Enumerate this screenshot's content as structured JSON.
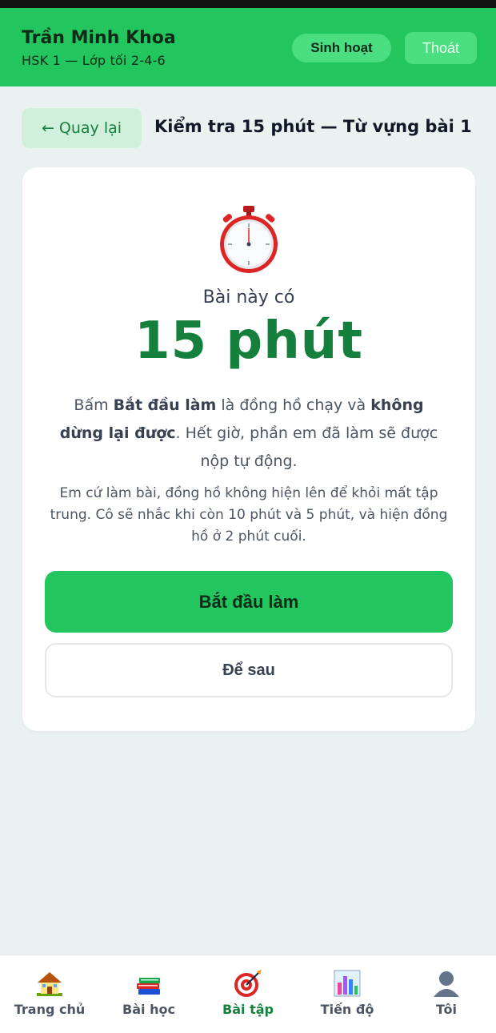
{
  "header": {
    "user_name": "Trần Minh Khoa",
    "class_name": "HSK 1 — Lớp tối 2-4-6",
    "activity_label": "Sinh hoạt",
    "logout_label": "Thoát"
  },
  "nav_bar": {
    "back_label": "Quay lại",
    "page_title": "Kiểm tra 15 phút — Từ vựng bài 1"
  },
  "card": {
    "has_text": "Bài này có",
    "duration": "15 phút",
    "para1": {
      "t1": "Bấm ",
      "b1": "Bắt đầu làm",
      "t2": " là đồng hồ chạy và ",
      "b2": "không dừng lại được",
      "t3": ". Hết giờ, phần em đã làm sẽ được nộp tự động."
    },
    "para2": "Em cứ làm bài, đồng hồ không hiện lên để khỏi mất tập trung. Cô sẽ nhắc khi còn 10 phút và 5 phút, và hiện đồng hồ ở 2 phút cuối.",
    "start_label": "Bắt đầu làm",
    "later_label": "Để sau",
    "icon": "stopwatch-icon"
  },
  "bottom_nav": {
    "items": [
      {
        "label": "Trang chủ",
        "icon": "house-icon"
      },
      {
        "label": "Bài học",
        "icon": "books-icon"
      },
      {
        "label": "Bài tập",
        "icon": "target-icon",
        "active": true
      },
      {
        "label": "Tiến độ",
        "icon": "bar-chart-icon"
      },
      {
        "label": "Tôi",
        "icon": "user-icon"
      }
    ]
  },
  "colors": {
    "brand": "#22c55e",
    "brand_dark": "#15803d",
    "background": "#eaf2f1"
  }
}
